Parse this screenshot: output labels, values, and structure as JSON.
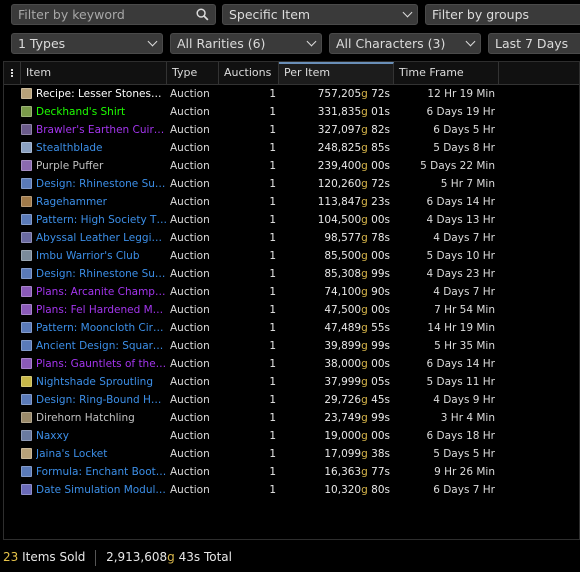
{
  "filters": {
    "search": {
      "placeholder": "Filter by keyword"
    },
    "item_mode": "Specific Item",
    "group_filter": "Filter by groups",
    "types": "1 Types",
    "rarities": "All Rarities (6)",
    "characters": "All Characters (3)",
    "timeframe": "Last 7 Days"
  },
  "table": {
    "headers": {
      "item": "Item",
      "type": "Type",
      "auctions": "Auctions",
      "per_item": "Per Item",
      "time_frame": "Time Frame"
    },
    "rows": [
      {
        "icon": "recipe-scroll-icon",
        "icon_color": "#b8a27a",
        "name": "Recipe: Lesser Stonesh…",
        "name_color": "#ffffff",
        "type": "Auction",
        "auctions": "1",
        "gold": "757,205",
        "silver": "72",
        "time": "12 Hr 19 Min"
      },
      {
        "icon": "shirt-icon",
        "icon_color": "#7a9a4a",
        "name": "Deckhand's Shirt",
        "name_color": "#1eff00",
        "type": "Auction",
        "auctions": "1",
        "gold": "331,835",
        "silver": "01",
        "time": "6 Days 19 Hr"
      },
      {
        "icon": "chest-armor-icon",
        "icon_color": "#6a5a8a",
        "name": "Brawler's Earthen Cuir…",
        "name_color": "#a335ee",
        "type": "Auction",
        "auctions": "1",
        "gold": "327,097",
        "silver": "82",
        "time": "6 Days 5 Hr"
      },
      {
        "icon": "blade-icon",
        "icon_color": "#8aa0c0",
        "name": "Stealthblade",
        "name_color": "#3c8fe8",
        "type": "Auction",
        "auctions": "1",
        "gold": "248,825",
        "silver": "85",
        "time": "5 Days 8 Hr"
      },
      {
        "icon": "pet-icon",
        "icon_color": "#8a6ab0",
        "name": "Purple Puffer",
        "name_color": "#c0c0c0",
        "type": "Auction",
        "auctions": "1",
        "gold": "239,400",
        "silver": "00",
        "time": "5 Days 22 Min"
      },
      {
        "icon": "design-scroll-icon",
        "icon_color": "#5a7ab8",
        "name": "Design: Rhinestone Sun…",
        "name_color": "#3c8fe8",
        "type": "Auction",
        "auctions": "1",
        "gold": "120,260",
        "silver": "72",
        "time": "5 Hr 7 Min"
      },
      {
        "icon": "hammer-icon",
        "icon_color": "#a07a4a",
        "name": "Ragehammer",
        "name_color": "#3c8fe8",
        "type": "Auction",
        "auctions": "1",
        "gold": "113,847",
        "silver": "23",
        "time": "6 Days 14 Hr"
      },
      {
        "icon": "pattern-scroll-icon",
        "icon_color": "#5a7ab8",
        "name": "Pattern: High Society T…",
        "name_color": "#3c8fe8",
        "type": "Auction",
        "auctions": "1",
        "gold": "104,500",
        "silver": "00",
        "time": "4 Days 13 Hr"
      },
      {
        "icon": "leggings-icon",
        "icon_color": "#6a6aa0",
        "name": "Abyssal Leather Leggin…",
        "name_color": "#3c8fe8",
        "type": "Auction",
        "auctions": "1",
        "gold": "98,577",
        "silver": "78",
        "time": "4 Days 7 Hr"
      },
      {
        "icon": "club-icon",
        "icon_color": "#7a8a9a",
        "name": "Imbu Warrior's Club",
        "name_color": "#3c8fe8",
        "type": "Auction",
        "auctions": "1",
        "gold": "85,500",
        "silver": "00",
        "time": "5 Days 10 Hr"
      },
      {
        "icon": "design-scroll-icon",
        "icon_color": "#5a7ab8",
        "name": "Design: Rhinestone Sun…",
        "name_color": "#3c8fe8",
        "type": "Auction",
        "auctions": "1",
        "gold": "85,308",
        "silver": "99",
        "time": "4 Days 23 Hr"
      },
      {
        "icon": "plans-scroll-icon",
        "icon_color": "#8a5ab8",
        "name": "Plans: Arcanite Champi…",
        "name_color": "#a335ee",
        "type": "Auction",
        "auctions": "1",
        "gold": "74,100",
        "silver": "90",
        "time": "4 Days 7 Hr"
      },
      {
        "icon": "plans-scroll-icon",
        "icon_color": "#8a5ab8",
        "name": "Plans: Fel Hardened M…",
        "name_color": "#a335ee",
        "type": "Auction",
        "auctions": "1",
        "gold": "47,500",
        "silver": "00",
        "time": "7 Hr 54 Min"
      },
      {
        "icon": "pattern-scroll-icon",
        "icon_color": "#5a7ab8",
        "name": "Pattern: Mooncloth Cir…",
        "name_color": "#3c8fe8",
        "type": "Auction",
        "auctions": "1",
        "gold": "47,489",
        "silver": "55",
        "time": "14 Hr 19 Min"
      },
      {
        "icon": "design-scroll-icon",
        "icon_color": "#5a7ab8",
        "name": "Ancient Design: Square…",
        "name_color": "#3c8fe8",
        "type": "Auction",
        "auctions": "1",
        "gold": "39,899",
        "silver": "99",
        "time": "5 Hr 35 Min"
      },
      {
        "icon": "plans-scroll-icon",
        "icon_color": "#8a5ab8",
        "name": "Plans: Gauntlets of the…",
        "name_color": "#a335ee",
        "type": "Auction",
        "auctions": "1",
        "gold": "38,000",
        "silver": "00",
        "time": "6 Days 14 Hr"
      },
      {
        "icon": "pet-icon",
        "icon_color": "#c8b84a",
        "name": "Nightshade Sproutling",
        "name_color": "#3c8fe8",
        "type": "Auction",
        "auctions": "1",
        "gold": "37,999",
        "silver": "05",
        "time": "5 Days 11 Hr"
      },
      {
        "icon": "design-scroll-icon",
        "icon_color": "#5a7ab8",
        "name": "Design: Ring-Bound H…",
        "name_color": "#3c8fe8",
        "type": "Auction",
        "auctions": "1",
        "gold": "29,726",
        "silver": "45",
        "time": "4 Days 9 Hr"
      },
      {
        "icon": "pet-icon",
        "icon_color": "#9a8a6a",
        "name": "Direhorn Hatchling",
        "name_color": "#c0c0c0",
        "type": "Auction",
        "auctions": "1",
        "gold": "23,749",
        "silver": "99",
        "time": "3 Hr 4 Min"
      },
      {
        "icon": "pet-icon",
        "icon_color": "#6a7aa0",
        "name": "Naxxy",
        "name_color": "#3c8fe8",
        "type": "Auction",
        "auctions": "1",
        "gold": "19,000",
        "silver": "00",
        "time": "6 Days 18 Hr"
      },
      {
        "icon": "scroll-icon",
        "icon_color": "#b8a27a",
        "name": "Jaina's Locket",
        "name_color": "#3c8fe8",
        "type": "Auction",
        "auctions": "1",
        "gold": "17,099",
        "silver": "38",
        "time": "5 Days 5 Hr"
      },
      {
        "icon": "formula-scroll-icon",
        "icon_color": "#5a7ab8",
        "name": "Formula: Enchant Boot…",
        "name_color": "#3c8fe8",
        "type": "Auction",
        "auctions": "1",
        "gold": "16,363",
        "silver": "77",
        "time": "9 Hr 26 Min"
      },
      {
        "icon": "book-icon",
        "icon_color": "#6a6ab8",
        "name": "Date Simulation Modul…",
        "name_color": "#3c8fe8",
        "type": "Auction",
        "auctions": "1",
        "gold": "10,320",
        "silver": "80",
        "time": "6 Days 7 Hr"
      }
    ]
  },
  "currency": {
    "gold_suffix": "g",
    "silver_suffix": "s"
  },
  "summary": {
    "count": "23",
    "label": "Items Sold",
    "total_gold": "2,913,608",
    "total_silver": "43",
    "total_label": "Total"
  },
  "colors": {
    "gold": "#d8b64a",
    "accent": "#6a8fb8",
    "count": "#e6c34a"
  }
}
